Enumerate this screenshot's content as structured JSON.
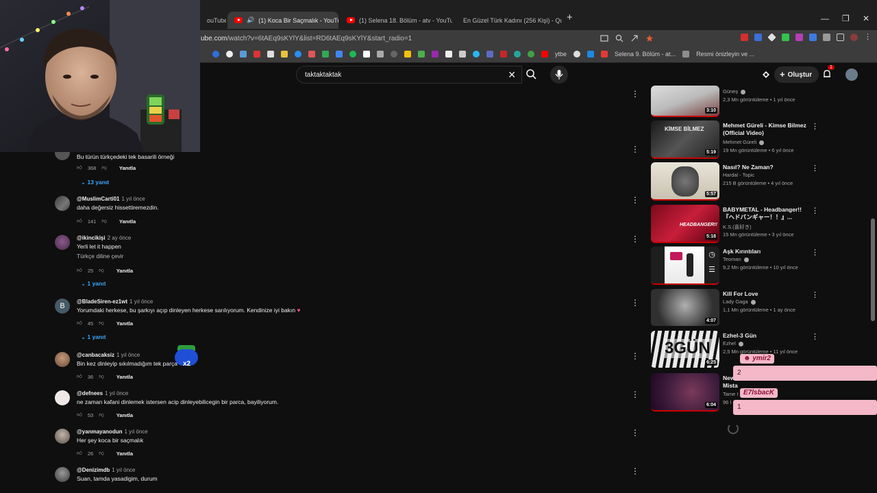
{
  "browser": {
    "tabs": [
      {
        "title": "ouTube",
        "active": false
      },
      {
        "title": "(1) Koca Bir Saçmalık - YouTub",
        "active": true
      },
      {
        "title": "(1) Selena 18. Bölüm - atv - YouTube",
        "active": false
      },
      {
        "title": "En Güzel Türk Kadını (256 Kişi) - Quiz",
        "active": false
      }
    ],
    "url_domain": "ube.com",
    "url_path": "/watch?v=6tAEq9sKYlY&list=RD6tAEq9sKYlY&start_radio=1",
    "bookmark_labels": [
      "ytbe",
      "Selena 9. Bölüm - at...",
      "Resmi önizleyin ve ..."
    ]
  },
  "youtube": {
    "search_query": "taktaktaktak",
    "create_label": "Oluştur",
    "notif_count": "1"
  },
  "comments": [
    {
      "author": "",
      "time": "",
      "text": "Bu türün türkçedeki tek basarili örneği",
      "likes": "368",
      "reply_label": "Yanıtla",
      "replies": "13 yanıt"
    },
    {
      "author": "@MuslimCarti01",
      "time": "1 yıl önce",
      "text": "daha değersiz hissettiremezdin.",
      "likes": "141",
      "reply_label": "Yanıtla",
      "replies": ""
    },
    {
      "author": "@ikincikişi",
      "time": "2 ay önce",
      "text": "Yerli let it happen",
      "text2": "Türkçe diline çevir",
      "likes": "25",
      "reply_label": "Yanıtla",
      "replies": "1 yanıt"
    },
    {
      "author": "@BladeSiren-ez1wt",
      "time": "1 yıl önce",
      "text": "Yorumdaki herkese, bu şarkıyı açıp dinleyen herkese sarılıyorum. Kendinize iyi bakın",
      "likes": "45",
      "reply_label": "Yanıtla",
      "replies": "1 yanıt"
    },
    {
      "author": "@canbacaksiz",
      "time": "1 yıl önce",
      "text": "Bin kez dinleyip sıkılmadığım tek parça",
      "likes": "36",
      "reply_label": "Yanıtla",
      "replies": ""
    },
    {
      "author": "@defnees",
      "time": "1 yıl önce",
      "text": "ne zaman kafani dinlemek istersen acip dinleyebilicegin bir parca, bayiliyorum.",
      "likes": "53",
      "reply_label": "Yanıtla",
      "replies": ""
    },
    {
      "author": "@yanmayanodun",
      "time": "1 yıl önce",
      "text": "Her şey koca bir saçmalık",
      "likes": "26",
      "reply_label": "Yanıtla",
      "replies": ""
    },
    {
      "author": "@Denizimdb",
      "time": "1 yıl önce",
      "text": "Suan, tamda yasadigim, durum",
      "likes": "",
      "reply_label": "",
      "replies": ""
    }
  ],
  "sidebar_videos": [
    {
      "title": "",
      "channel": "Güneş",
      "meta": "2,3 Mn görüntüleme • 1 yıl önce",
      "duration": "3:10"
    },
    {
      "title": "Mehmet Güreli - Kimse Bilmez (Official Video)",
      "channel": "Mehmet Güreli",
      "meta": "19 Mn görüntüleme • 6 yıl önce",
      "duration": "5:19"
    },
    {
      "title": "Nasıl? Ne Zaman?",
      "channel": "Hardal - Topic",
      "meta": "215 B görüntüleme • 4 yıl önce",
      "duration": "5:57"
    },
    {
      "title": "BABYMETAL - Headbanger!! 『ヘドバンギャー！！』...",
      "channel": "K.S.(喜好き)",
      "meta": "15 Mn görüntüleme • 3 yıl önce",
      "duration": "5:18"
    },
    {
      "title": "Aşk Kırıntıları",
      "channel": "Teoman",
      "meta": "9,2 Mn görüntüleme • 10 yıl önce",
      "duration": ""
    },
    {
      "title": "Kill For Love",
      "channel": "Lady Gaga",
      "meta": "1,1 Mn görüntüleme • 1 ay önce",
      "duration": "4:07"
    },
    {
      "title": "Ezhel-3 Gün",
      "channel": "Ezhel",
      "meta": "2,5 Mn görüntüleme • 11 yıl önce",
      "duration": "6:25"
    },
    {
      "title": "New Mistakes",
      "channel": "Tame I",
      "meta": "96 I",
      "duration": "6:04"
    }
  ],
  "stream_overlay": {
    "chat": [
      {
        "name": "ymir2",
        "count": "2"
      },
      {
        "name": "E7lsbacK",
        "count": "1"
      }
    ]
  },
  "colors": {
    "background": "#0f0f0f",
    "link_blue": "#3ea6ff",
    "yt_red": "#ff0000",
    "chat_pink": "#f4b8c8"
  }
}
